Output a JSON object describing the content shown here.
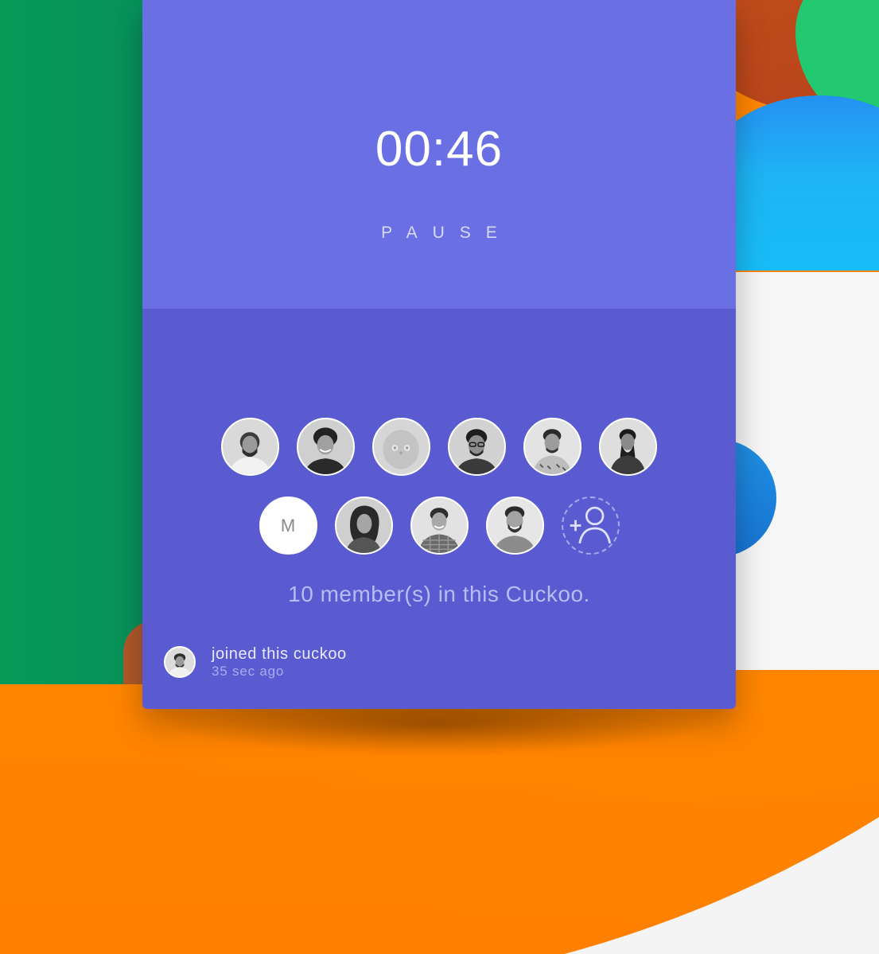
{
  "timer": {
    "value": "00:46",
    "pause_label": "PAUSE"
  },
  "members": {
    "row_1": [
      {
        "name": "member-avatar-1",
        "kind": "photo"
      },
      {
        "name": "member-avatar-2",
        "kind": "photo"
      },
      {
        "name": "member-avatar-3",
        "kind": "placeholder-bird"
      },
      {
        "name": "member-avatar-4",
        "kind": "photo"
      },
      {
        "name": "member-avatar-5",
        "kind": "photo"
      },
      {
        "name": "member-avatar-6",
        "kind": "photo"
      }
    ],
    "row_2": [
      {
        "name": "member-avatar-7",
        "kind": "initial",
        "initial": "M"
      },
      {
        "name": "member-avatar-8",
        "kind": "photo"
      },
      {
        "name": "member-avatar-9",
        "kind": "photo"
      },
      {
        "name": "member-avatar-10",
        "kind": "photo"
      }
    ],
    "add_icon": "add-user-icon",
    "initial_m": "M",
    "count_text": "10 member(s) in this Cuckoo."
  },
  "activity": {
    "message": "joined this cuckoo",
    "time": "35 sec ago"
  },
  "colors": {
    "timer_panel": "#6a6fe3",
    "members_panel": "#5a5bd1",
    "accent_text": "#b9bcf4"
  }
}
